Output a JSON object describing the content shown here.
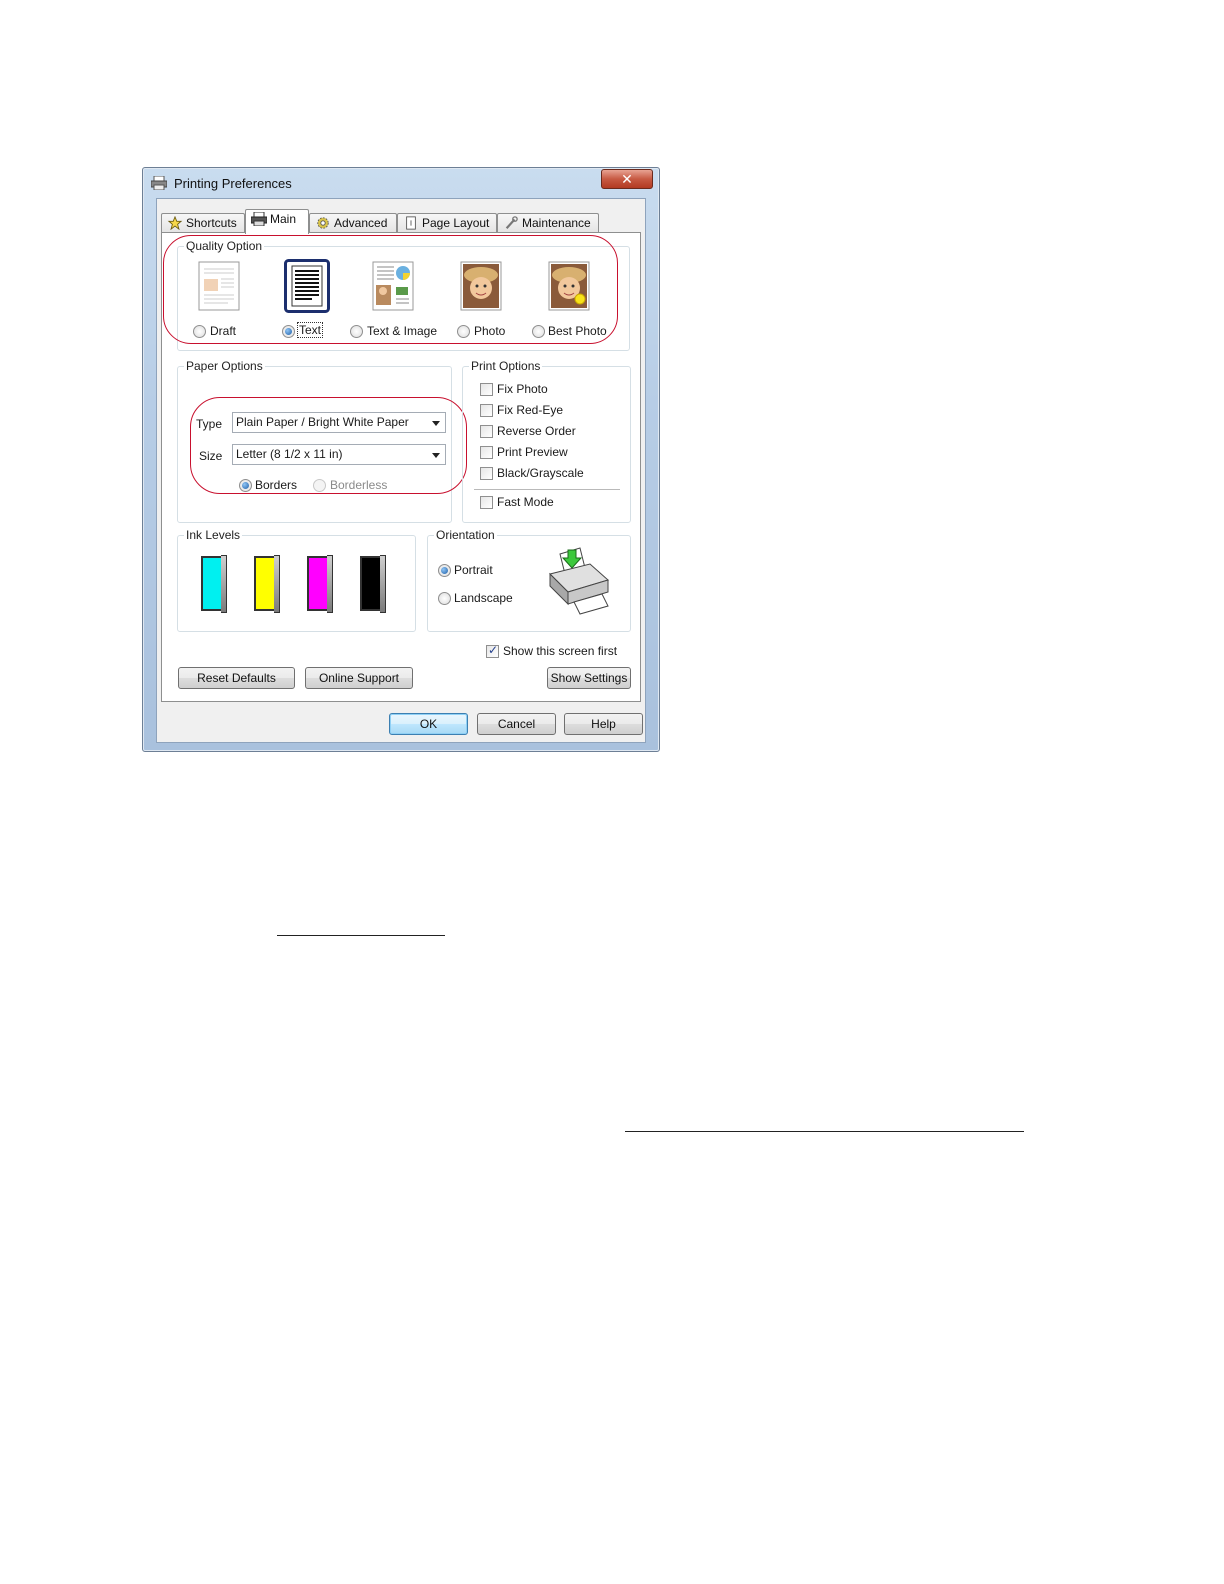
{
  "window": {
    "title": "Printing Preferences",
    "close_glyph": "✕"
  },
  "tabs": [
    {
      "label": "Shortcuts",
      "icon": "star-icon"
    },
    {
      "label": "Main",
      "icon": "printer-icon"
    },
    {
      "label": "Advanced",
      "icon": "gear-icon"
    },
    {
      "label": "Page Layout",
      "icon": "page-icon"
    },
    {
      "label": "Maintenance",
      "icon": "wrench-icon"
    }
  ],
  "quality": {
    "legend": "Quality Option",
    "options": [
      {
        "label": "Draft",
        "selected": false
      },
      {
        "label": "Text",
        "selected": true
      },
      {
        "label": "Text & Image",
        "selected": false
      },
      {
        "label": "Photo",
        "selected": false
      },
      {
        "label": "Best Photo",
        "selected": false
      }
    ]
  },
  "paper": {
    "legend": "Paper Options",
    "type_label": "Type",
    "type_value": "Plain Paper / Bright White Paper",
    "size_label": "Size",
    "size_value": "Letter (8 1/2 x 11 in)",
    "borders_label": "Borders",
    "borderless_label": "Borderless"
  },
  "print_options": {
    "legend": "Print Options",
    "items": [
      {
        "label": "Fix Photo",
        "checked": false
      },
      {
        "label": "Fix Red-Eye",
        "checked": false
      },
      {
        "label": "Reverse Order",
        "checked": false
      },
      {
        "label": "Print Preview",
        "checked": false
      },
      {
        "label": "Black/Grayscale",
        "checked": false
      },
      {
        "label": "Fast Mode",
        "checked": false
      }
    ]
  },
  "ink": {
    "legend": "Ink Levels",
    "cartridges": [
      {
        "color": "#00f0f0"
      },
      {
        "color": "#ffff00"
      },
      {
        "color": "#ff00ff"
      },
      {
        "color": "#000000"
      }
    ]
  },
  "orientation": {
    "legend": "Orientation",
    "portrait_label": "Portrait",
    "landscape_label": "Landscape"
  },
  "show_first_label": "Show this screen first",
  "buttons": {
    "reset": "Reset Defaults",
    "online": "Online Support",
    "show_settings": "Show Settings",
    "ok": "OK",
    "cancel": "Cancel",
    "help": "Help"
  },
  "colors": {
    "callout": "#c8102e",
    "title_bar": "#b7cde6",
    "default_button": "#3c7fb1"
  }
}
